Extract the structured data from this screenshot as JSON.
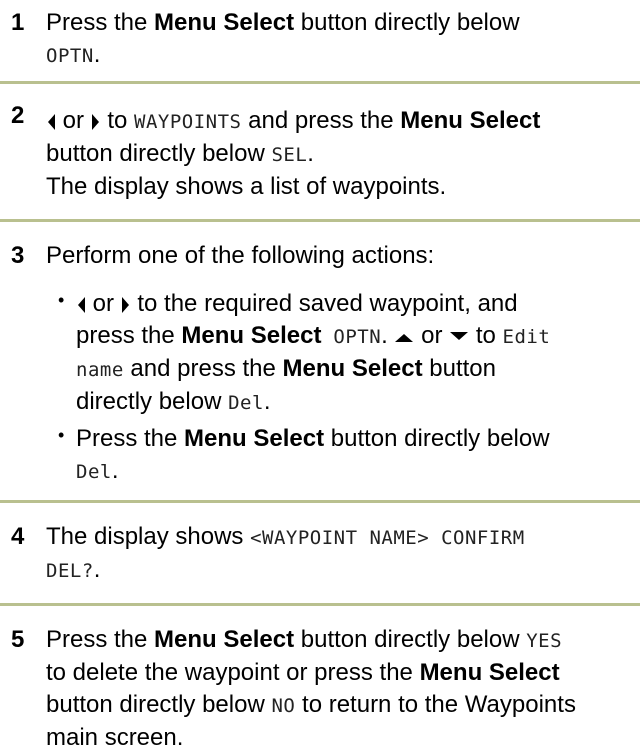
{
  "steps": [
    {
      "num": "1",
      "t1": "Press the ",
      "b1": "Menu Select",
      "t2": " button directly below",
      "m1": "OPTN",
      "t3": "."
    },
    {
      "num": "2",
      "or1": "or",
      "t1": " to ",
      "m1": "WAYPOINTS",
      "t2": " and press the ",
      "b1": "Menu Select",
      "t3": "button directly below ",
      "m2": "SEL",
      "t4": ".",
      "t5": "The display shows a list of waypoints."
    },
    {
      "num": "3",
      "t1": "Perform one of the following actions:",
      "bulletA": {
        "or1": "or",
        "t1": " to the required saved waypoint, and",
        "t2": "press the ",
        "b1": "Menu Select",
        "m1": " OPTN",
        "t3": ". ",
        "or2": " or ",
        "t4": " to ",
        "m2": "Edit",
        "m3": "name",
        "t5": " and press the ",
        "b2": "Menu Select",
        "t6": " button",
        "t7": "directly below ",
        "m4": "Del",
        "t8": "."
      },
      "bulletB": {
        "t1": "Press the ",
        "b1": "Menu Select",
        "t2": " button directly below",
        "m1": "Del",
        "t3": "."
      }
    },
    {
      "num": "4",
      "t1": "The display shows ",
      "m1": "<WAYPOINT NAME> CONFIRM",
      "m2": "DEL?",
      "t2": "."
    },
    {
      "num": "5",
      "t1": "Press the ",
      "b1": "Menu Select",
      "t2": " button directly below ",
      "m1": "YES",
      "t3": "to delete the waypoint or press the ",
      "b2": "Menu Select",
      "t4": "button directly below ",
      "m2": "NO",
      "t5": " to return to the Waypoints",
      "t6": "main screen."
    }
  ],
  "icons": {
    "left": "left-arrow-icon",
    "right": "right-arrow-icon",
    "up": "up-arrow-icon",
    "down": "down-arrow-icon"
  },
  "colors": {
    "separator": "#b9c08f"
  }
}
